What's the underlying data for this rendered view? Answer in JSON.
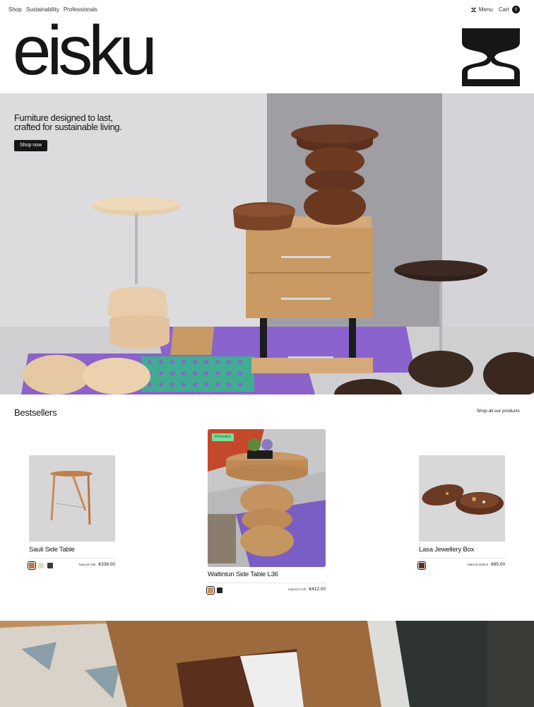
{
  "nav": {
    "left": [
      "Shop",
      "Sustainability",
      "Professionals"
    ],
    "menu_label": "Menu",
    "cart_label": "Cart",
    "cart_count": "0"
  },
  "brand": {
    "wordmark": "eisku"
  },
  "hero": {
    "headline_line1": "Furniture designed to last,",
    "headline_line2": "crafted for sustainable living.",
    "cta": "Shop now"
  },
  "bestsellers": {
    "title": "Bestsellers",
    "shop_all": "Shop all our products",
    "products": [
      {
        "name": "Sauli Side Table",
        "material": "Natural Oak",
        "price": "€336.00",
        "swatches": [
          "#b87a48",
          "#e6d9cc",
          "#3a3a3a"
        ]
      },
      {
        "name": "Waltintun Side Table L36",
        "badge": "Promotion",
        "material": "Natural Cork",
        "price": "€412.00",
        "swatches": [
          "#c9935e",
          "#222222"
        ]
      },
      {
        "name": "Lasa Jewellery Box",
        "material": "Natural Walnut",
        "price": "€85.00",
        "swatches": [
          "#5a3322"
        ]
      }
    ]
  },
  "colors": {
    "ink": "#161616",
    "hero_bg": "#d9d9db",
    "promotion_badge": "#7ddc9a"
  }
}
